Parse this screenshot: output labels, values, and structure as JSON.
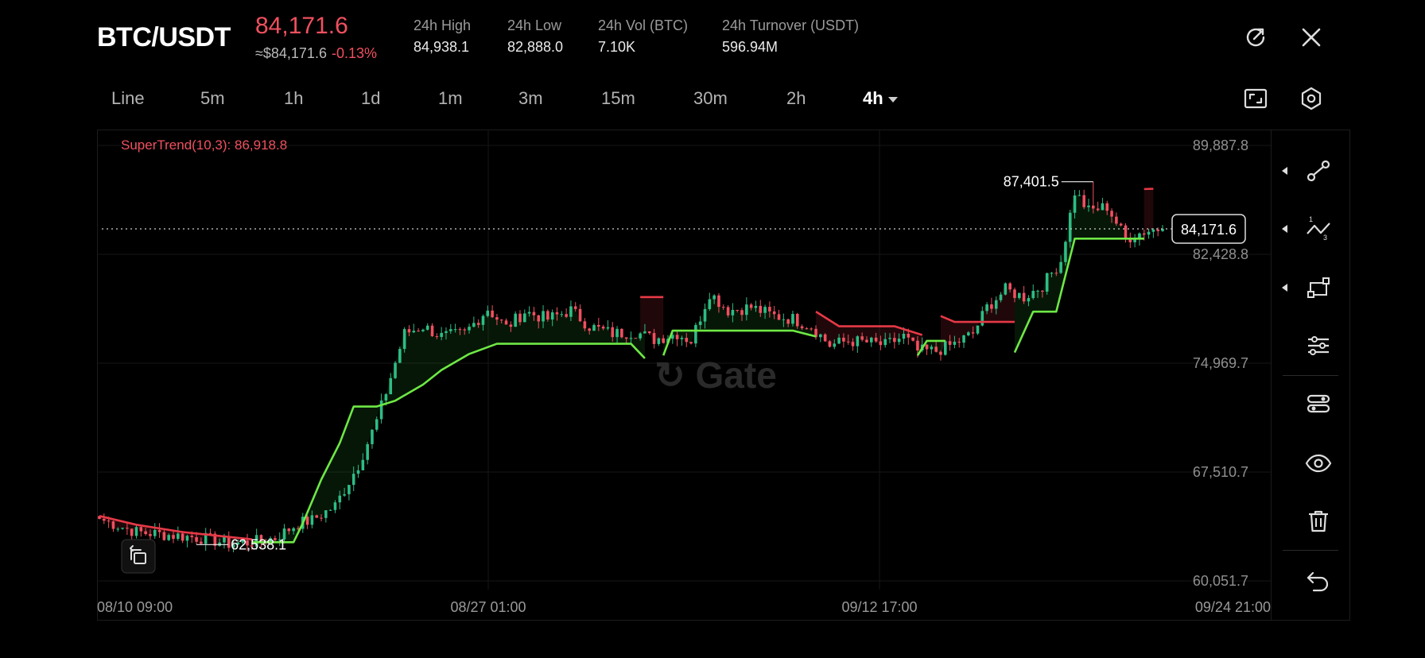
{
  "header": {
    "pair": "BTC/USDT",
    "last_price": "84,171.6",
    "usd_price": "≈$84,171.6",
    "change": "-0.13%",
    "stats": [
      {
        "label": "24h   High",
        "value": "84,938.1"
      },
      {
        "label": "24h   Low",
        "value": "82,888.0"
      },
      {
        "label": "24h   Vol (BTC)",
        "value": "7.10K"
      },
      {
        "label": "24h   Turnover (USDT)",
        "value": "596.94M"
      }
    ],
    "icons": [
      "rotate-screen-icon",
      "close-icon"
    ]
  },
  "timeframes": [
    "Line",
    "5m",
    "1h",
    "1d",
    "1m",
    "3m",
    "15m",
    "30m",
    "2h",
    "4h"
  ],
  "active_timeframe": "4h",
  "toolbar_icons": [
    "screenshot-icon",
    "settings-icon"
  ],
  "side_tools": [
    "trend-line-icon",
    "fib-tool-icon",
    "path-tool-icon",
    "indicator-settings-icon",
    "layers-icon",
    "visibility-icon",
    "delete-icon",
    "undo-icon"
  ],
  "colors": {
    "up": "#2ebd85",
    "down": "#f0505f",
    "supertrend_up": "#6ee845",
    "supertrend_down": "#e63946",
    "background": "#000000"
  },
  "chart_data": {
    "type": "candlestick",
    "symbol": "BTC/USDT",
    "interval": "4h",
    "indicator_label": "SuperTrend(10,3): 86,918.8",
    "y_ticks": [
      "89,887.8",
      "82,428.8",
      "74,969.7",
      "67,510.7",
      "60,051.7"
    ],
    "y_range": [
      60051.7,
      89887.8
    ],
    "x_ticks": [
      "08/10 09:00",
      "08/27 01:00",
      "09/12 17:00",
      "09/24 21:00"
    ],
    "current_price_label": "84,171.6",
    "current_price": 84171.6,
    "max_label": "87,401.5",
    "min_label": "62,538.1",
    "close_path": [
      [
        0,
        64300
      ],
      [
        8,
        63400
      ],
      [
        15,
        63200
      ],
      [
        22,
        63000
      ],
      [
        28,
        62600
      ],
      [
        33,
        62700
      ],
      [
        38,
        63000
      ],
      [
        43,
        64000
      ],
      [
        46,
        64200
      ],
      [
        51,
        65200
      ],
      [
        56,
        68000
      ],
      [
        60,
        71000
      ],
      [
        64,
        75000
      ],
      [
        66,
        77000
      ],
      [
        70,
        77500
      ],
      [
        74,
        76800
      ],
      [
        79,
        77000
      ],
      [
        84,
        78700
      ],
      [
        88,
        77400
      ],
      [
        92,
        78500
      ],
      [
        97,
        78000
      ],
      [
        102,
        78600
      ],
      [
        106,
        77500
      ],
      [
        111,
        77000
      ],
      [
        116,
        77100
      ],
      [
        120,
        76600
      ],
      [
        125,
        77000
      ],
      [
        128,
        76500
      ],
      [
        132,
        79800
      ],
      [
        136,
        78600
      ],
      [
        141,
        78800
      ],
      [
        146,
        78200
      ],
      [
        150,
        78000
      ],
      [
        154,
        77500
      ],
      [
        158,
        76200
      ],
      [
        162,
        76500
      ],
      [
        166,
        76400
      ],
      [
        170,
        76200
      ],
      [
        174,
        76800
      ],
      [
        177,
        75800
      ],
      [
        181,
        75800
      ],
      [
        185,
        76300
      ],
      [
        189,
        77000
      ],
      [
        192,
        78800
      ],
      [
        196,
        80000
      ],
      [
        200,
        79500
      ],
      [
        204,
        80300
      ],
      [
        208,
        82000
      ],
      [
        211,
        86700
      ],
      [
        214,
        85400
      ],
      [
        218,
        85700
      ],
      [
        222,
        83500
      ],
      [
        226,
        84000
      ],
      [
        229,
        84171.6
      ]
    ],
    "min_point": [
      21,
      62538.1
    ],
    "max_point": [
      215,
      87401.5
    ],
    "supertrend": [
      {
        "dir": "down",
        "points": [
          [
            0,
            64500
          ],
          [
            8,
            63900
          ],
          [
            18,
            63400
          ],
          [
            24,
            63200
          ],
          [
            33,
            62900
          ]
        ]
      },
      {
        "dir": "up",
        "points": [
          [
            33,
            62700
          ],
          [
            42,
            62700
          ],
          [
            44,
            64000
          ],
          [
            48,
            67000
          ],
          [
            52,
            69500
          ],
          [
            55,
            72000
          ],
          [
            60,
            72000
          ],
          [
            64,
            72400
          ],
          [
            70,
            73500
          ],
          [
            74,
            74500
          ],
          [
            80,
            75600
          ],
          [
            86,
            76300
          ],
          [
            92,
            76300
          ],
          [
            100,
            76300
          ],
          [
            115,
            76300
          ],
          [
            118,
            75300
          ]
        ]
      },
      {
        "dir": "down",
        "points": [
          [
            117,
            79500
          ],
          [
            122,
            79500
          ]
        ]
      },
      {
        "dir": "up",
        "points": [
          [
            122,
            75500
          ],
          [
            124,
            77200
          ],
          [
            150,
            77200
          ],
          [
            155,
            76800
          ]
        ]
      },
      {
        "dir": "down",
        "points": [
          [
            155,
            78500
          ],
          [
            160,
            77500
          ],
          [
            172,
            77500
          ],
          [
            178,
            76900
          ]
        ]
      },
      {
        "dir": "up",
        "points": [
          [
            177,
            75500
          ],
          [
            179,
            76500
          ],
          [
            183,
            76500
          ]
        ]
      },
      {
        "dir": "down",
        "points": [
          [
            182,
            78200
          ],
          [
            185,
            77800
          ],
          [
            198,
            77800
          ]
        ]
      },
      {
        "dir": "up",
        "points": [
          [
            198,
            75700
          ],
          [
            202,
            78500
          ],
          [
            207,
            78500
          ],
          [
            211,
            83500
          ],
          [
            216,
            83500
          ],
          [
            226,
            83500
          ]
        ]
      },
      {
        "dir": "down",
        "points": [
          [
            226,
            86900
          ],
          [
            228,
            86918.8
          ]
        ]
      }
    ]
  }
}
